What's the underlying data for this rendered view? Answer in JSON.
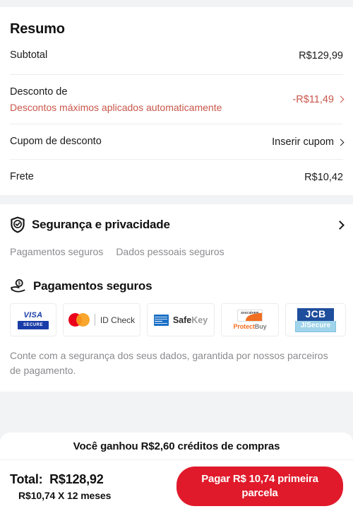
{
  "summary": {
    "title": "Resumo",
    "rows": [
      {
        "label": "Subtotal",
        "value": "R$129,99"
      },
      {
        "label": "Desconto de",
        "sublabel": "Descontos máximos aplicados automaticamente",
        "value": "-R$11,49"
      },
      {
        "label": "Cupom de desconto",
        "value": "Inserir cupom"
      },
      {
        "label": "Frete",
        "value": "R$10,42"
      }
    ]
  },
  "security": {
    "title": "Segurança e privacidade",
    "tags": [
      "Pagamentos seguros",
      "Dados pessoais seguros"
    ],
    "payments_title": "Pagamentos seguros",
    "logos": [
      {
        "name": "visa-secure",
        "primary": "VISA",
        "secondary": "SECURE"
      },
      {
        "name": "mastercard-id-check",
        "primary": "ID Check"
      },
      {
        "name": "amex-safekey",
        "primary": "Safe",
        "secondary": "Key"
      },
      {
        "name": "discover-protectbuy",
        "primary": "DISCØVER",
        "secondary": "Protect",
        "tertiary": "Buy"
      },
      {
        "name": "jcb-j-secure",
        "primary": "JCB",
        "secondary": "J/Secure"
      }
    ],
    "note": "Conte com a segurança dos seus dados, garantida por nossos parceiros de pagamento."
  },
  "checkout": {
    "credit_banner": "Você ganhou R$2,60 créditos de compras",
    "total_label": "Total:",
    "total_value": "R$128,92",
    "installments": "R$10,74 X 12 meses",
    "pay_button": "Pagar R$ 10,74 primeira parcela"
  },
  "colors": {
    "brand_red": "#e01a2b",
    "discount_red": "#c9564a",
    "page_bg": "#f2f3f4",
    "muted_text": "#8b8b8f"
  }
}
